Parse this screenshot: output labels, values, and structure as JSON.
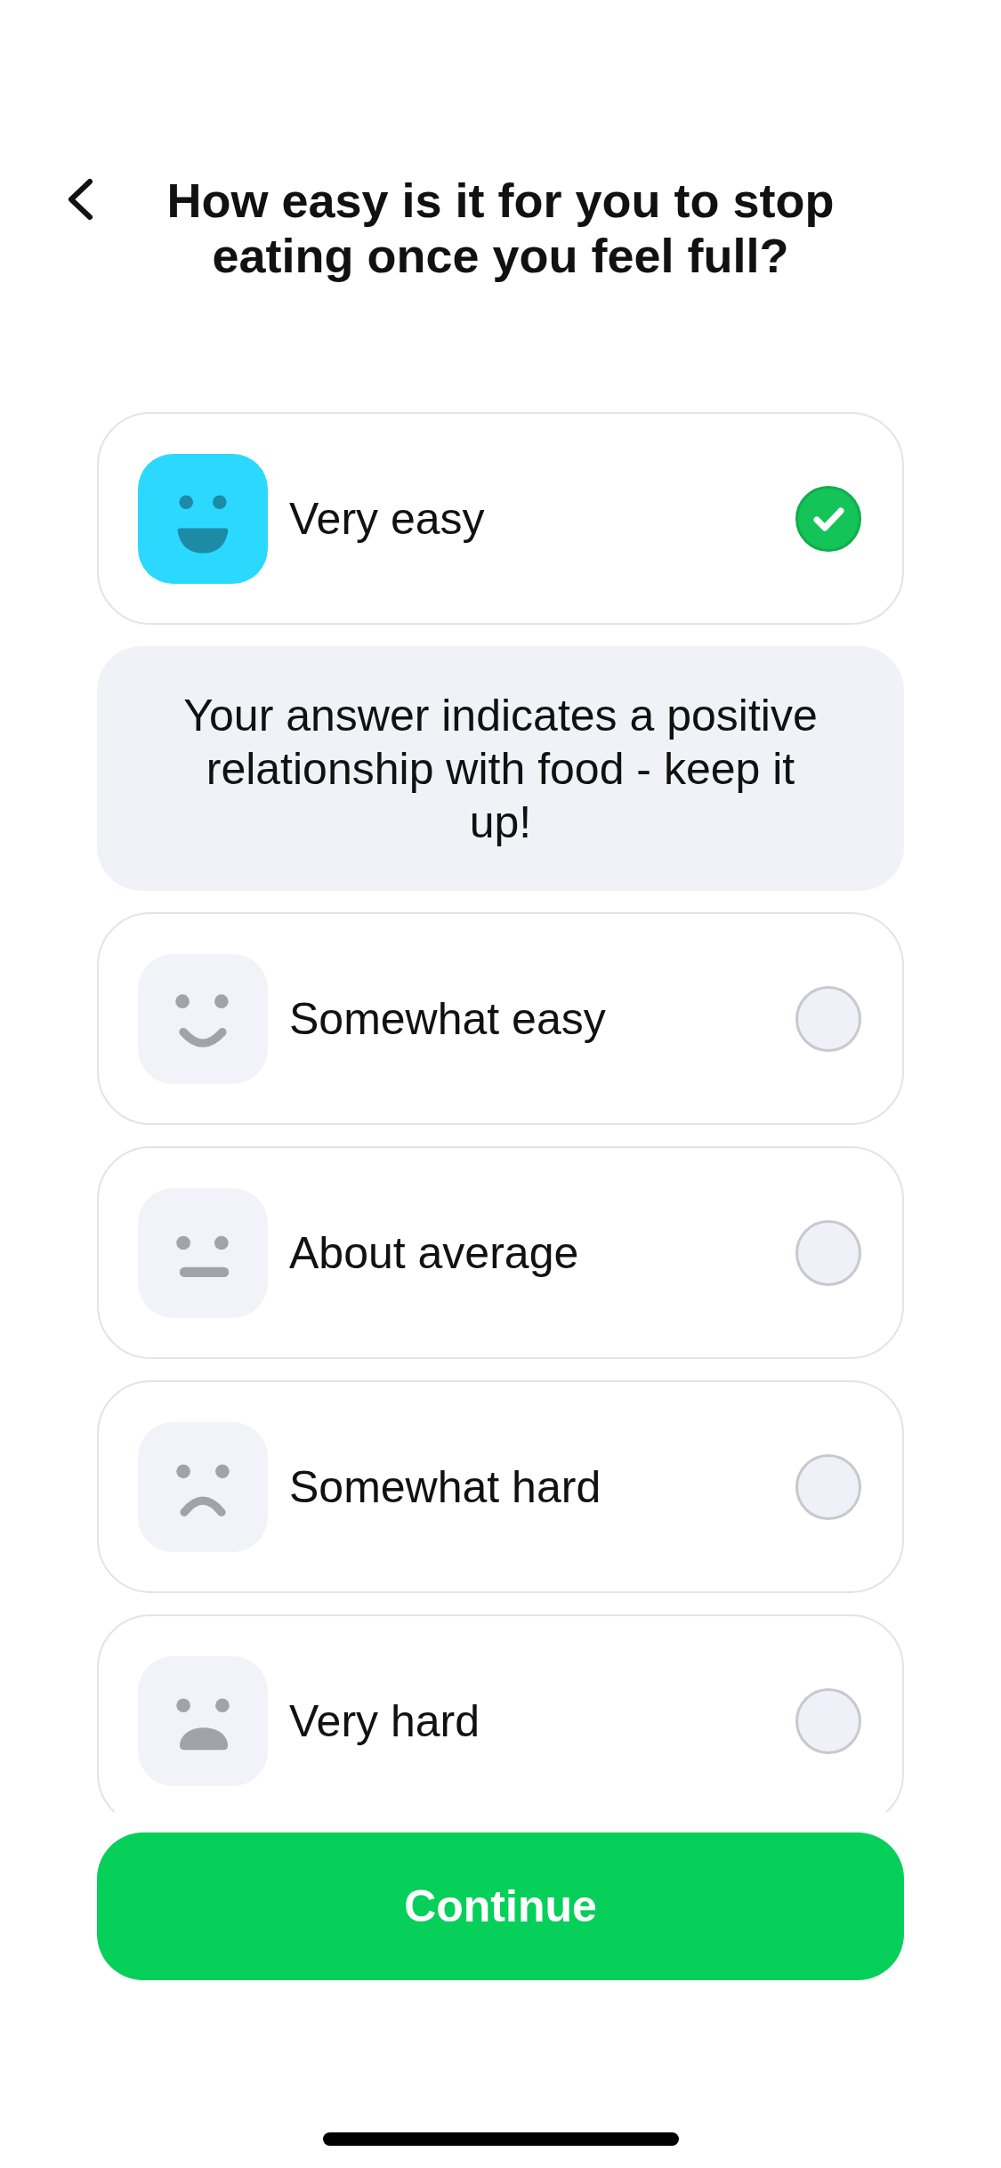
{
  "header": {
    "title": "How easy is it for you to stop eating once you feel full?"
  },
  "options": [
    {
      "kind": "grin",
      "label": "Very easy",
      "selected": true,
      "feedback": "Your answer indicates a positive relationship with food - keep it up!"
    },
    {
      "kind": "smile",
      "label": "Somewhat easy",
      "selected": false
    },
    {
      "kind": "neutral",
      "label": "About average",
      "selected": false
    },
    {
      "kind": "frown",
      "label": "Somewhat hard",
      "selected": false
    },
    {
      "kind": "sad",
      "label": "Very hard",
      "selected": false
    }
  ],
  "continue_button": {
    "label": "Continue"
  }
}
